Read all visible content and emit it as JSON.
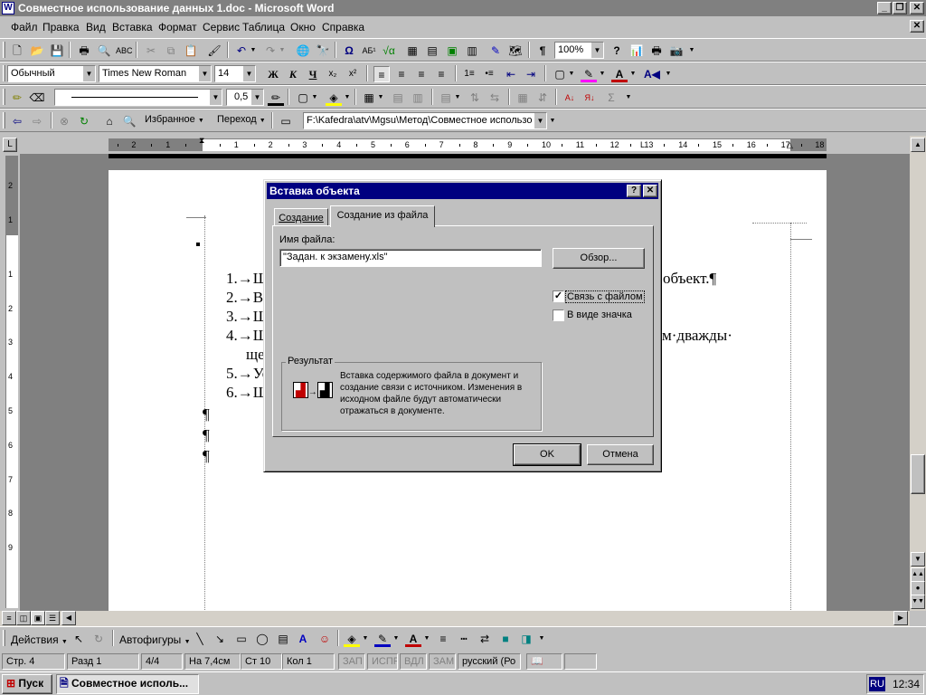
{
  "window": {
    "title": "Совместное использование данных 1.doc - Microsoft Word"
  },
  "menu": [
    "Файл",
    "Правка",
    "Вид",
    "Вставка",
    "Формат",
    "Сервис",
    "Таблица",
    "Окно",
    "Справка"
  ],
  "formatting": {
    "style": "Обычный",
    "font": "Times New Roman",
    "size": "14",
    "bold": "Ж",
    "italic": "К",
    "underline": "Ч"
  },
  "standard": {
    "zoom": "100%"
  },
  "drawing_line": {
    "weight": "0,5"
  },
  "web": {
    "favorites": "Избранное",
    "go": "Переход",
    "address": "F:\\Kafedra\\atv\\Mgsu\\Метод\\Совместное использо"
  },
  "ruler": {
    "ticks": [
      "2",
      "1",
      "1",
      "2",
      "3",
      "4",
      "5",
      "6",
      "7",
      "8",
      "9",
      "10",
      "11",
      "12",
      "13",
      "14",
      "15",
      "16",
      "17",
      "18"
    ],
    "vticks": [
      "2",
      "1",
      "1",
      "2",
      "3",
      "4",
      "5",
      "6",
      "7",
      "8",
      "9"
    ]
  },
  "document": {
    "lines": [
      "1.→Щ",
      "2.→Вы",
      "3.→Щ",
      "4.→Щ",
      "ще",
      "5.→Ус",
      "6.→Щ",
      "¶",
      "¶",
      "¶"
    ],
    "right_fragments": [
      "объект.¶",
      "м·дважды·"
    ]
  },
  "dialog": {
    "title": "Вставка объекта",
    "help": "?",
    "tabs": [
      "Создание",
      "Создание из файла"
    ],
    "filename_label": "Имя файла:",
    "filename_value": "\"Задан. к экзамену.xls\"",
    "browse": "Обзор...",
    "link_label": "Связь с файлом",
    "link_checked": true,
    "icon_label": "В виде значка",
    "icon_checked": false,
    "result_title": "Результат",
    "result_text": "Вставка содержимого файла в документ и создание связи с источником.  Изменения в исходном файле будут автоматически отражаться в документе.",
    "ok": "OK",
    "cancel": "Отмена"
  },
  "drawing": {
    "actions": "Действия",
    "autoshapes": "Автофигуры"
  },
  "status": {
    "page": "Стр. 4",
    "section": "Разд 1",
    "pages": "4/4",
    "at": "На 7,4см",
    "line": "Ст 10",
    "col": "Кол 1",
    "rec": "ЗАП",
    "trk": "ИСПР",
    "ext": "ВДЛ",
    "ovr": "ЗАМ",
    "lang": "русский (Ро"
  },
  "taskbar": {
    "start": "Пуск",
    "task": "Совместное исполь...",
    "lang": "RU",
    "time": "12:34"
  },
  "colors": {
    "titlebar_inactive": "#808080",
    "dialog_title": "#000080",
    "desktop_gray": "#c0c0c0",
    "task_blue": "#000080"
  }
}
